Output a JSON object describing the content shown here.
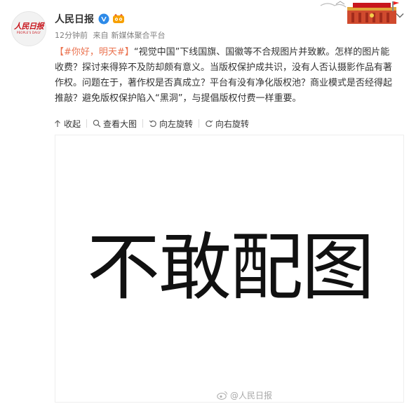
{
  "author": {
    "name": "人民日报",
    "avatar_logo_text": "人民日报",
    "avatar_logo_sub": "PEOPLE'S DAILY"
  },
  "meta": {
    "time": "12分钟前",
    "source_prefix": "来自",
    "source": "新媒体聚合平台"
  },
  "post": {
    "bracket_open": "【",
    "hashtag": "#你好，明天#",
    "bracket_close": "】",
    "body": "“视觉中国”下线国旗、国徽等不合规图片并致歉。怎样的图片能收费？探讨来得猝不及防却颇有意义。当版权保护成共识，没有人否认摄影作品有著作权。问题在于，著作权是否真成立？平台有没有净化版权池？商业模式是否经得起推敲？避免版权保护陷入“黑洞”，与提倡版权付费一样重要。"
  },
  "actions": {
    "collapse": "收起",
    "view_large": "查看大图",
    "rotate_left": "向左旋转",
    "rotate_right": "向右旋转"
  },
  "image": {
    "text": "不敢配图",
    "watermark": "@人民日报"
  },
  "colors": {
    "hashtag": "#eb7350",
    "verified": "#f7a000",
    "brand_red": "#c8161d"
  },
  "icons": [
    "verified-v-icon",
    "vip-badge-icon",
    "chevron-down-icon",
    "collapse-arrow-icon",
    "zoom-search-icon",
    "rotate-left-icon",
    "rotate-right-icon",
    "weibo-watermark-icon",
    "decorative-banner"
  ]
}
